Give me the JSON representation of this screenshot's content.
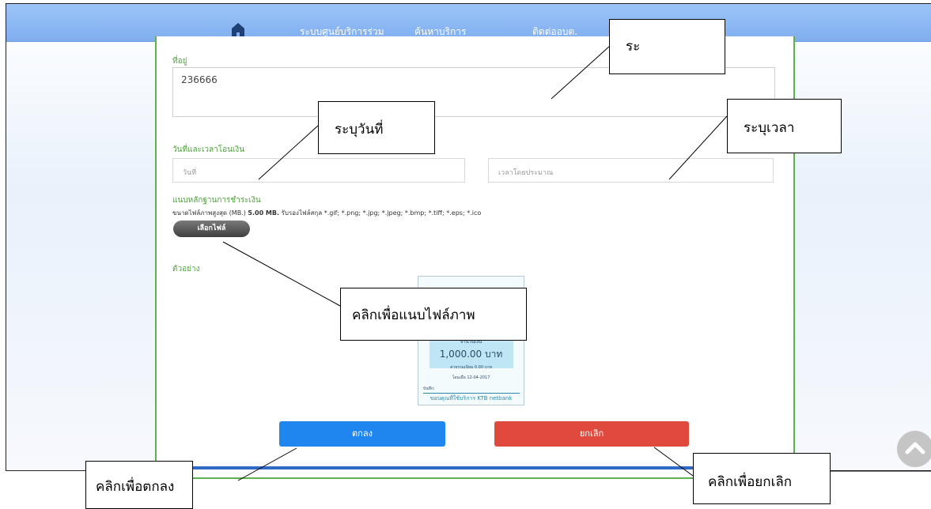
{
  "navbar": {
    "home_icon": "home-icon",
    "links": [
      "ระบบศูนย์บริการร่วม",
      "ค้นหาบริการ",
      "ติดต่ออบต."
    ]
  },
  "form": {
    "address_label": "ที่อยู่",
    "address_value": "236666",
    "transfer_label": "วันที่และเวลาโอนเงิน",
    "date_placeholder": "วันที่",
    "time_placeholder": "เวลาโดยประมาณ",
    "attach_label": "แนบหลักฐานการชำระเงิน",
    "file_note_prefix": "ขนาดไฟล์ภาพสูงสุด (MB.)",
    "file_note_size": "5.00 MB.",
    "file_note_suffix": "รับรองไฟล์สกุล *.gif; *.png; *.jpg; *.jpeg; *.bmp; *.tiff; *.eps; *.ico",
    "choose_file_label": "เลือกไฟล์",
    "example_label": "ตัวอย่าง"
  },
  "receipt_example": {
    "amount_label": "จำนวนเงิน",
    "amount": "1,000.00 บาท",
    "fee": "ค่าธรรมเนียม 0.00 บาท",
    "date": "โอนเมื่อ 12-04-2017",
    "memo_label": "บันทึก:",
    "footer": "ขอบคุณที่ใช้บริการ KTB netbank"
  },
  "buttons": {
    "ok_label": "ตกลง",
    "cancel_label": "ยกเลิก"
  },
  "callouts": {
    "address": "ระ",
    "date": "ระบุวันที่",
    "time": "ระบุเวลา",
    "attach": "คลิกเพื่อแนบไฟล์ภาพ",
    "ok": "คลิกเพื่อตกลง",
    "cancel": "คลิกเพื่อยกเลิก"
  },
  "colors": {
    "navbar": "#8ab8f3",
    "label_green": "#4ea33b",
    "ok_blue": "#1e86ee",
    "cancel_red": "#e04a3c"
  }
}
